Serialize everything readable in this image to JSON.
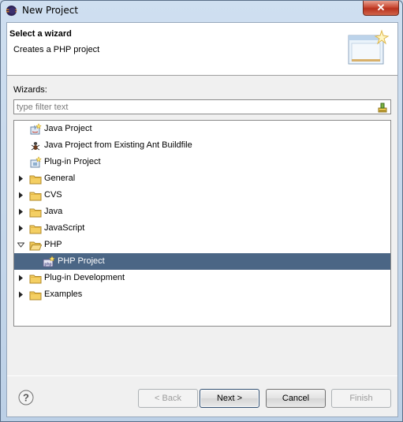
{
  "window": {
    "title": "New Project"
  },
  "header": {
    "title": "Select a wizard",
    "description": "Creates a PHP project"
  },
  "wizards_label": "Wizards:",
  "filter": {
    "placeholder": "type filter text",
    "value": ""
  },
  "tree": [
    {
      "label": "Java Project",
      "type": "item",
      "level": 1,
      "icon": "java-project-icon"
    },
    {
      "label": "Java Project from Existing Ant Buildfile",
      "type": "item",
      "level": 1,
      "icon": "ant-icon"
    },
    {
      "label": "Plug-in Project",
      "type": "item",
      "level": 1,
      "icon": "plugin-project-icon"
    },
    {
      "label": "General",
      "type": "folder",
      "expanded": false,
      "icon": "folder-icon"
    },
    {
      "label": "CVS",
      "type": "folder",
      "expanded": false,
      "icon": "folder-icon"
    },
    {
      "label": "Java",
      "type": "folder",
      "expanded": false,
      "icon": "folder-icon"
    },
    {
      "label": "JavaScript",
      "type": "folder",
      "expanded": false,
      "icon": "folder-icon"
    },
    {
      "label": "PHP",
      "type": "folder",
      "expanded": true,
      "icon": "folder-open-icon"
    },
    {
      "label": "PHP Project",
      "type": "item",
      "level": 2,
      "selected": true,
      "icon": "php-project-icon"
    },
    {
      "label": "Plug-in Development",
      "type": "folder",
      "expanded": false,
      "icon": "folder-icon"
    },
    {
      "label": "Examples",
      "type": "folder",
      "expanded": false,
      "icon": "folder-icon"
    }
  ],
  "buttons": {
    "back": {
      "label": "< Back",
      "enabled": false
    },
    "next": {
      "label": "Next >",
      "enabled": true
    },
    "cancel": {
      "label": "Cancel",
      "enabled": true
    },
    "finish": {
      "label": "Finish",
      "enabled": false
    }
  },
  "colors": {
    "selection": "#4b6685",
    "close_button": "#c94a34"
  }
}
